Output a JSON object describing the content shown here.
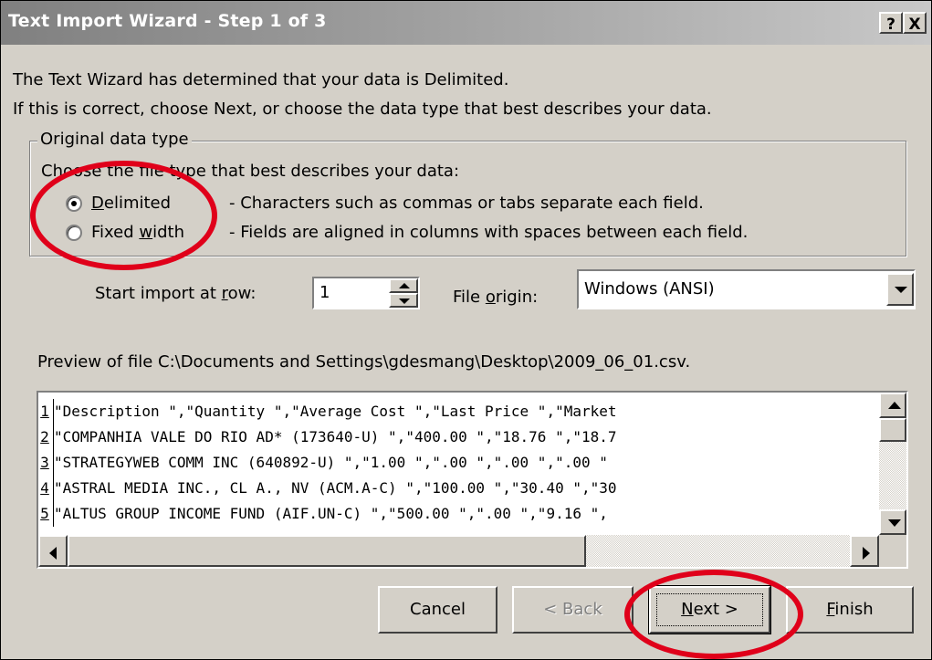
{
  "dialog": {
    "title": "Text Import Wizard - Step 1 of 3",
    "help_button": "?",
    "close_button": "X"
  },
  "intro": {
    "line1": "The Text Wizard has determined that your data is Delimited.",
    "line2": "If this is correct, choose Next, or choose the data type that best describes your data."
  },
  "original_data_type": {
    "legend": "Original data type",
    "prompt": "Choose the file type that best describes your data:",
    "options": [
      {
        "label": "Delimited",
        "accel": "D",
        "description": "- Characters such as commas or tabs separate each field.",
        "selected": true
      },
      {
        "label": "Fixed width",
        "accel": "w",
        "description": "- Fields are aligned in columns with spaces between each field.",
        "selected": false
      }
    ]
  },
  "start_import": {
    "label": "Start import at row:",
    "value": "1"
  },
  "file_origin": {
    "label": "File origin:",
    "value": "Windows (ANSI)"
  },
  "preview": {
    "label": "Preview of file C:\\Documents and Settings\\gdesmang\\Desktop\\2009_06_01.csv.",
    "rows": [
      {
        "num": "1",
        "text": "\"Description \",\"Quantity \",\"Average Cost \",\"Last Price \",\"Market"
      },
      {
        "num": "2",
        "text": "\"COMPANHIA VALE DO RIO AD* (173640-U) \",\"400.00 \",\"18.76 \",\"18.7"
      },
      {
        "num": "3",
        "text": "\"STRATEGYWEB COMM INC (640892-U) \",\"1.00 \",\".00 \",\".00 \",\".00 \""
      },
      {
        "num": "4",
        "text": "\"ASTRAL MEDIA INC., CL A., NV (ACM.A-C) \",\"100.00 \",\"30.40 \",\"30"
      },
      {
        "num": "5",
        "text": "\"ALTUS GROUP INCOME FUND (AIF.UN-C) \",\"500.00 \",\".00 \",\"9.16 \","
      }
    ]
  },
  "buttons": {
    "cancel": "Cancel",
    "back": "< Back",
    "next": "Next >",
    "finish": "Finish"
  },
  "colors": {
    "annotation_circle": "#e0001a",
    "dialog_face": "#d4d0c8"
  }
}
